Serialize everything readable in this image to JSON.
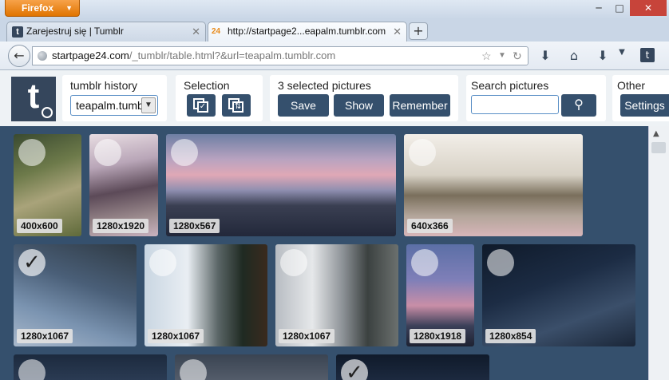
{
  "browser": {
    "menu_label": "Firefox",
    "tabs": [
      {
        "title": "Zarejestruj się | Tumblr",
        "favicon": "t"
      },
      {
        "title": "http://startpage2...eapalm.tumblr.com",
        "favicon": "24"
      }
    ],
    "url_host": "startpage24.com",
    "url_path": "/_tumblr/table.html?&url=teapalm.tumblr.com"
  },
  "toolbar": {
    "history_label": "tumblr history",
    "history_value": "teapalm.tumblr",
    "selection_label": "Selection",
    "selected_label": "3 selected pictures",
    "save_label": "Save",
    "show_label": "Show",
    "remember_label": "Remember",
    "search_label": "Search pictures",
    "search_value": "",
    "other_label": "Other",
    "settings_label": "Settings"
  },
  "pictures": [
    {
      "dims": "400x600",
      "selected": false
    },
    {
      "dims": "1280x1920",
      "selected": false
    },
    {
      "dims": "1280x567",
      "selected": false
    },
    {
      "dims": "640x366",
      "selected": false
    },
    {
      "dims": "1280x1067",
      "selected": true
    },
    {
      "dims": "1280x1067",
      "selected": false
    },
    {
      "dims": "1280x1067",
      "selected": false
    },
    {
      "dims": "1280x1918",
      "selected": false
    },
    {
      "dims": "1280x854",
      "selected": false
    },
    {
      "dims": "",
      "selected": false
    },
    {
      "dims": "",
      "selected": false
    },
    {
      "dims": "",
      "selected": true
    }
  ],
  "colors": {
    "accent": "#35506d",
    "tumblr": "#35465c",
    "close": "#c7443a"
  }
}
